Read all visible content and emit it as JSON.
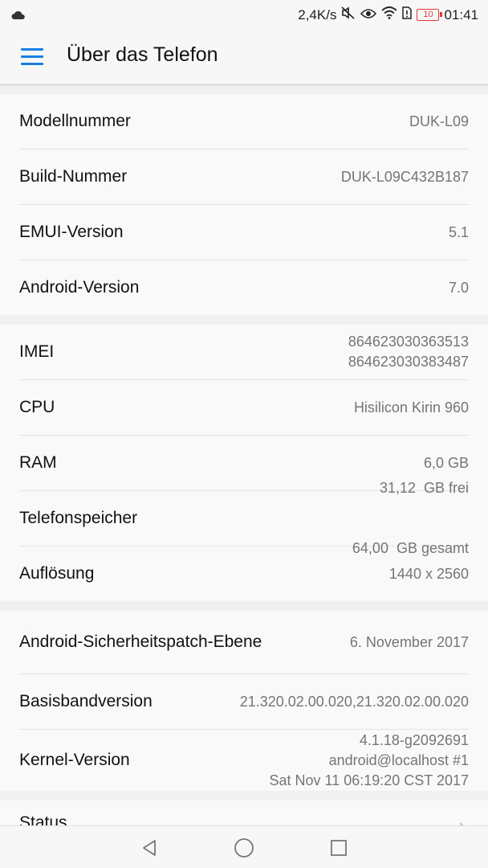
{
  "statusbar": {
    "net_speed": "2,4K/s",
    "battery_level": "10",
    "time": "01:41",
    "icons": [
      "cloud-icon",
      "mute-icon",
      "eye-icon",
      "wifi-icon",
      "sim-alert-icon",
      "battery-icon"
    ]
  },
  "header": {
    "title": "Über das Telefon"
  },
  "groups": [
    {
      "rows": [
        {
          "label": "Modellnummer",
          "value": "DUK-L09"
        },
        {
          "label": "Build-Nummer",
          "value": "DUK-L09C432B187"
        },
        {
          "label": "EMUI-Version",
          "value": "5.1"
        },
        {
          "label": "Android-Version",
          "value": "7.0"
        }
      ]
    },
    {
      "rows": [
        {
          "label": "IMEI",
          "value": [
            "864623030363513",
            "864623030383487"
          ]
        },
        {
          "label": "CPU",
          "value": "Hisilicon Kirin 960"
        },
        {
          "label": "RAM",
          "value": "6,0 GB"
        },
        {
          "label": "Telefonspeicher",
          "value": [
            "31,12  GB frei",
            "64,00  GB gesamt"
          ]
        },
        {
          "label": "Auflösung",
          "value": "1440 x 2560"
        }
      ]
    },
    {
      "rows": [
        {
          "label": "Android-Sicherheitspatch-Ebene",
          "value": "6. November 2017"
        },
        {
          "label": "Basisbandversion",
          "value": "21.320.02.00.020,21.320.02.00.020"
        },
        {
          "label": "Kernel-Version",
          "value": [
            "4.1.18-g2092691",
            "android@localhost #1",
            "Sat Nov 11 06:19:20 CST 2017"
          ]
        }
      ]
    },
    {
      "rows": [
        {
          "label": "Status"
        }
      ]
    }
  ],
  "navbar": {
    "icons": [
      "back-icon",
      "home-icon",
      "recents-icon"
    ]
  }
}
